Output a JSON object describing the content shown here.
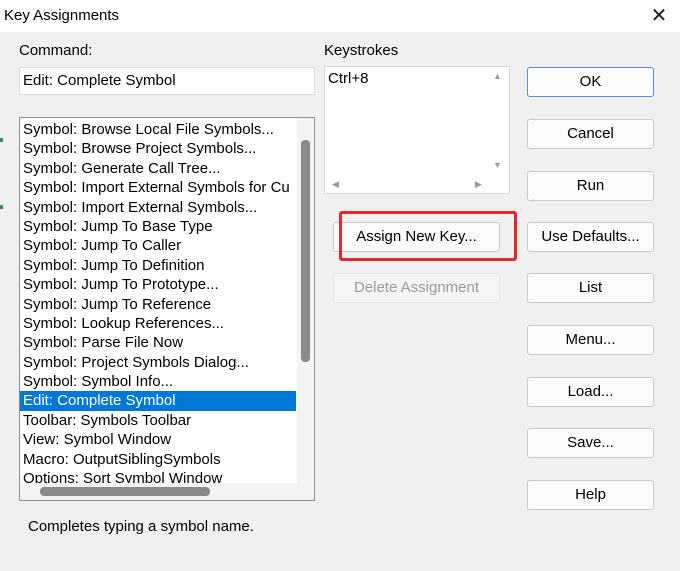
{
  "window": {
    "title": "Key Assignments",
    "close_glyph": "✕"
  },
  "command": {
    "label": "Command:",
    "value": "Edit: Complete Symbol"
  },
  "keystrokes": {
    "label": "Keystrokes",
    "items": [
      "Ctrl+8"
    ]
  },
  "commands_list": {
    "items": [
      "Symbol: Browse Local File Symbols...",
      "Symbol: Browse Project Symbols...",
      "Symbol: Generate Call Tree...",
      "Symbol: Import External Symbols for Cu",
      "Symbol: Import External Symbols...",
      "Symbol: Jump To Base Type",
      "Symbol: Jump To Caller",
      "Symbol: Jump To Definition",
      "Symbol: Jump To Prototype...",
      "Symbol: Jump To Reference",
      "Symbol: Lookup References...",
      "Symbol: Parse File Now",
      "Symbol: Project Symbols Dialog...",
      "Symbol: Symbol Info...",
      "Edit: Complete Symbol",
      "Toolbar: Symbols Toolbar",
      "View: Symbol Window",
      "Macro: OutputSiblingSymbols",
      "Options: Sort Symbol Window"
    ],
    "selected": "Edit: Complete Symbol"
  },
  "buttons": {
    "assign_new_key": "Assign New Key...",
    "delete_assignment": "Delete Assignment",
    "ok": "OK",
    "cancel": "Cancel",
    "run": "Run",
    "use_defaults": "Use Defaults...",
    "list": "List",
    "menu": "Menu...",
    "load": "Load...",
    "save": "Save...",
    "help": "Help"
  },
  "status": "Completes typing a symbol name.",
  "colors": {
    "selection": "#0078d7",
    "highlight_box": "#e8262e",
    "default_button_border": "#5a8fd6"
  }
}
